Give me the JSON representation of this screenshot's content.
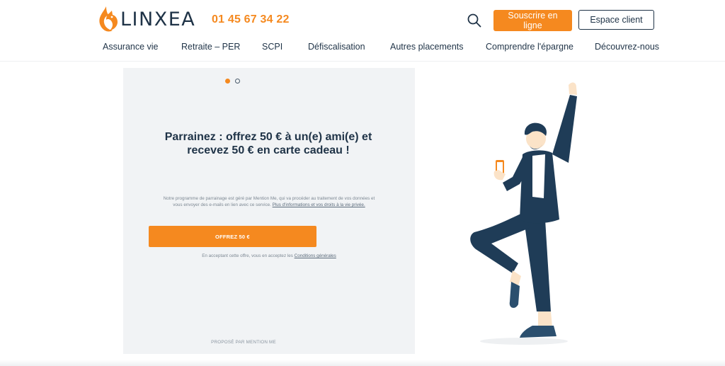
{
  "brand": {
    "name": "LINXEA",
    "phone": "01 45 67 34 22",
    "accent_color": "#f5891f",
    "navy_color": "#1f3347"
  },
  "header": {
    "search_icon": "search-icon",
    "subscribe_label": "Souscrire en ligne",
    "client_label": "Espace client"
  },
  "nav": {
    "items": [
      {
        "label": "Assurance vie"
      },
      {
        "label": "Retraite – PER"
      },
      {
        "label": "SCPI"
      },
      {
        "label": "Défiscalisation"
      },
      {
        "label": "Autres placements"
      },
      {
        "label": "Comprendre l'épargne"
      },
      {
        "label": "Découvrez-nous"
      }
    ]
  },
  "referral": {
    "carousel_dots": 2,
    "active_dot": 1,
    "title": "Parrainez : offrez 50 € à un(e) ami(e) et recevez 50 € en carte cadeau !",
    "info_text": "Notre programme de parrainage est géré par Mention Me, qui va procéder au traitement de vos données et vous envoyer des e-mails en lien avec ce service.",
    "info_link": "Plus d'informations et vos droits à la vie privée.",
    "cta_label": "OFFREZ 50 €",
    "terms_text": "En acceptant cette offre, vous en acceptez les",
    "terms_link": "Conditions générales",
    "footer": "PROPOSÉ PAR MENTION ME"
  },
  "illustration": {
    "icon": "celebrating-man-with-phone-illustration"
  }
}
